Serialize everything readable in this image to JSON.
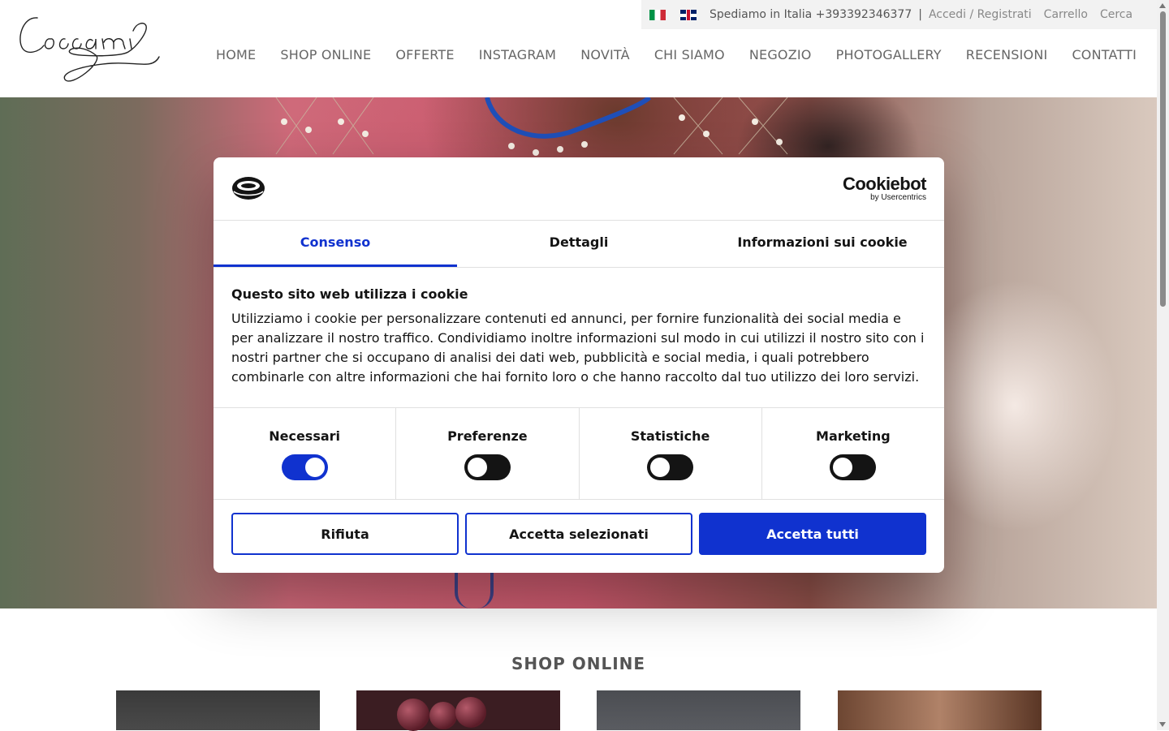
{
  "header": {
    "logo_text": "Coccami",
    "topbar": {
      "shipping_text": "Spediamo in Italia +393392346377",
      "separator": "|",
      "login_link": "Accedi / Registrati",
      "cart_link": "Carrello",
      "search_link": "Cerca"
    },
    "nav": [
      "HOME",
      "SHOP ONLINE",
      "OFFERTE",
      "INSTAGRAM",
      "NOVITÀ",
      "CHI SIAMO",
      "NEGOZIO",
      "PHOTOGALLERY",
      "RECENSIONI",
      "CONTATTI"
    ]
  },
  "section": {
    "title": "SHOP ONLINE"
  },
  "cookie_dialog": {
    "brand_name": "Cookiebot",
    "brand_sub": "by Usercentrics",
    "tabs": [
      "Consenso",
      "Dettagli",
      "Informazioni sui cookie"
    ],
    "active_tab": "Consenso",
    "title": "Questo sito web utilizza i cookie",
    "text": "Utilizziamo i cookie per personalizzare contenuti ed annunci, per fornire funzionalità dei social media e per analizzare il nostro traffico. Condividiamo inoltre informazioni sul modo in cui utilizzi il nostro sito con i nostri partner che si occupano di analisi dei dati web, pubblicità e social media, i quali potrebbero combinarle con altre informazioni che hai fornito loro o che hanno raccolto dal tuo utilizzo dei loro servizi.",
    "toggles": [
      {
        "label": "Necessari",
        "on": true
      },
      {
        "label": "Preferenze",
        "on": false
      },
      {
        "label": "Statistiche",
        "on": false
      },
      {
        "label": "Marketing",
        "on": false
      }
    ],
    "buttons": {
      "reject": "Rifiuta",
      "accept_selected": "Accetta selezionati",
      "accept_all": "Accetta tutti"
    },
    "accent_color": "#1032cf"
  }
}
